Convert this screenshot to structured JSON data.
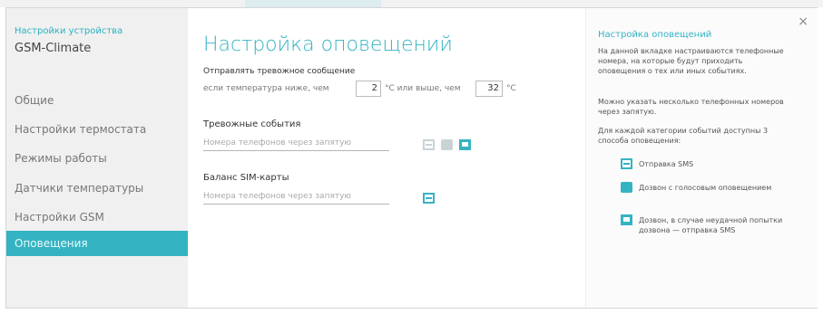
{
  "window": {
    "subtitle": "Настройки устройства",
    "device_name": "GSM-Climate",
    "close_glyph": "×"
  },
  "sidebar": {
    "items": [
      {
        "label": "Общие",
        "active": false
      },
      {
        "label": "Настройки термостата",
        "active": false
      },
      {
        "label": "Режимы работы",
        "active": false
      },
      {
        "label": "Датчики температуры",
        "active": false
      },
      {
        "label": "Настройки GSM",
        "active": false
      },
      {
        "label": "Оповещения",
        "active": true
      }
    ]
  },
  "main": {
    "title": "Настройка оповещений",
    "temp_alert": {
      "line1": "Отправлять тревожное сообщение",
      "line2_prefix": "если температура ниже, чем",
      "low_value": "2",
      "unit1": "°С или выше, чем",
      "high_value": "32",
      "unit2": "°С"
    },
    "section1_title": "Тревожные события",
    "section1_placeholder": "Номера телефонов через запятую",
    "section2_title": "Баланс SIM-карты",
    "section2_placeholder": "Номера телефонов через запятую"
  },
  "help": {
    "title": "Настройка оповещений",
    "para1": "На данной вкладке настраиваются телефонные номера, на которые будут приходить оповещения о тех или иных событиях.",
    "para2": "Можно указать несколько телефонных номеров через запятую.",
    "para3": "Для каждой категории событий доступны 3 способа оповещения:",
    "legend": [
      {
        "icon": "envelope-icon",
        "text": "Отправка SMS"
      },
      {
        "icon": "phone-icon",
        "text": "Дозвон с голосовым оповещением"
      },
      {
        "icon": "message-icon",
        "text": "Дозвон, в случае неудачной попытки дозвона — отправка SMS"
      }
    ]
  },
  "colors": {
    "accent": "#34b3c2",
    "sidebar_bg": "#f0f0f0"
  }
}
